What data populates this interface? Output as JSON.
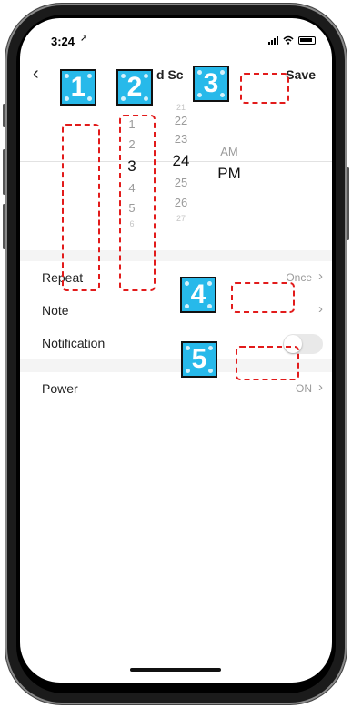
{
  "status_bar": {
    "time": "3:24",
    "location_icon": "location-arrow-icon",
    "signal_icon": "signal-icon",
    "wifi_icon": "wifi-icon",
    "battery_icon": "battery-icon"
  },
  "nav": {
    "back_icon": "chevron-left-icon",
    "title_fragment": "d Sc",
    "save_label": "Save"
  },
  "picker": {
    "hours": [
      "1",
      "2",
      "3",
      "4",
      "5",
      "6"
    ],
    "selected_hour": "3",
    "minutes": [
      "21",
      "22",
      "23",
      "24",
      "25",
      "26",
      "27"
    ],
    "selected_minute": "24",
    "meridiem": [
      "AM",
      "PM"
    ],
    "selected_meridiem": "PM"
  },
  "settings": {
    "repeat": {
      "label": "Repeat",
      "value": "Once"
    },
    "note": {
      "label": "Note"
    },
    "notification": {
      "label": "Notification",
      "enabled": false
    },
    "power": {
      "label": "Power",
      "value": "ON"
    }
  },
  "annotations": [
    "1",
    "2",
    "3",
    "4",
    "5"
  ],
  "colors": {
    "marker_fill": "#27b9ea",
    "marker_border": "#111111",
    "dashed_box": "#e21b1b"
  }
}
